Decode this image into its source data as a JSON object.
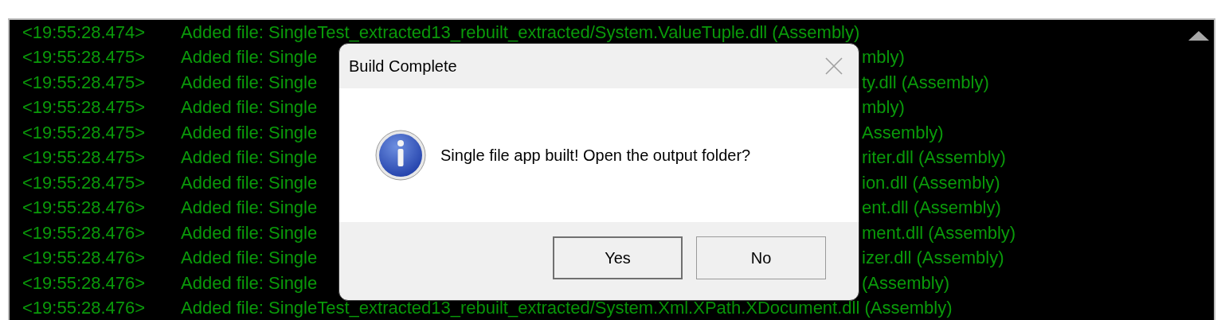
{
  "log": {
    "lines": [
      {
        "timestamp": "<19:55:28.474>",
        "text": "Added file: SingleTest_extracted13_rebuilt_extracted/System.ValueTuple.dll (Assembly)"
      },
      {
        "timestamp": "<19:55:28.475>",
        "text": "Added file: Single",
        "text_right": "mbly)"
      },
      {
        "timestamp": "<19:55:28.475>",
        "text": "Added file: Single",
        "text_right": "ty.dll (Assembly)"
      },
      {
        "timestamp": "<19:55:28.475>",
        "text": "Added file: Single",
        "text_right": "mbly)"
      },
      {
        "timestamp": "<19:55:28.475>",
        "text": "Added file: Single",
        "text_right": "Assembly)"
      },
      {
        "timestamp": "<19:55:28.475>",
        "text": "Added file: Single",
        "text_right": "riter.dll (Assembly)"
      },
      {
        "timestamp": "<19:55:28.475>",
        "text": "Added file: Single",
        "text_right": "ion.dll (Assembly)"
      },
      {
        "timestamp": "<19:55:28.476>",
        "text": "Added file: Single",
        "text_right": "ent.dll (Assembly)"
      },
      {
        "timestamp": "<19:55:28.476>",
        "text": "Added file: Single",
        "text_right": "ment.dll (Assembly)"
      },
      {
        "timestamp": "<19:55:28.476>",
        "text": "Added file: Single",
        "text_right": "izer.dll (Assembly)"
      },
      {
        "timestamp": "<19:55:28.476>",
        "text": "Added file: Single",
        "text_right": "(Assembly)"
      },
      {
        "timestamp": "<19:55:28.476>",
        "text": "Added file: SingleTest_extracted13_rebuilt_extracted/System.Xml.XPath.XDocument.dll (Assembly)"
      }
    ]
  },
  "dialog": {
    "title": "Build Complete",
    "message": "Single file app built! Open the output folder?",
    "buttons": [
      {
        "label": "Yes",
        "default": true
      },
      {
        "label": "No",
        "default": false
      }
    ]
  }
}
